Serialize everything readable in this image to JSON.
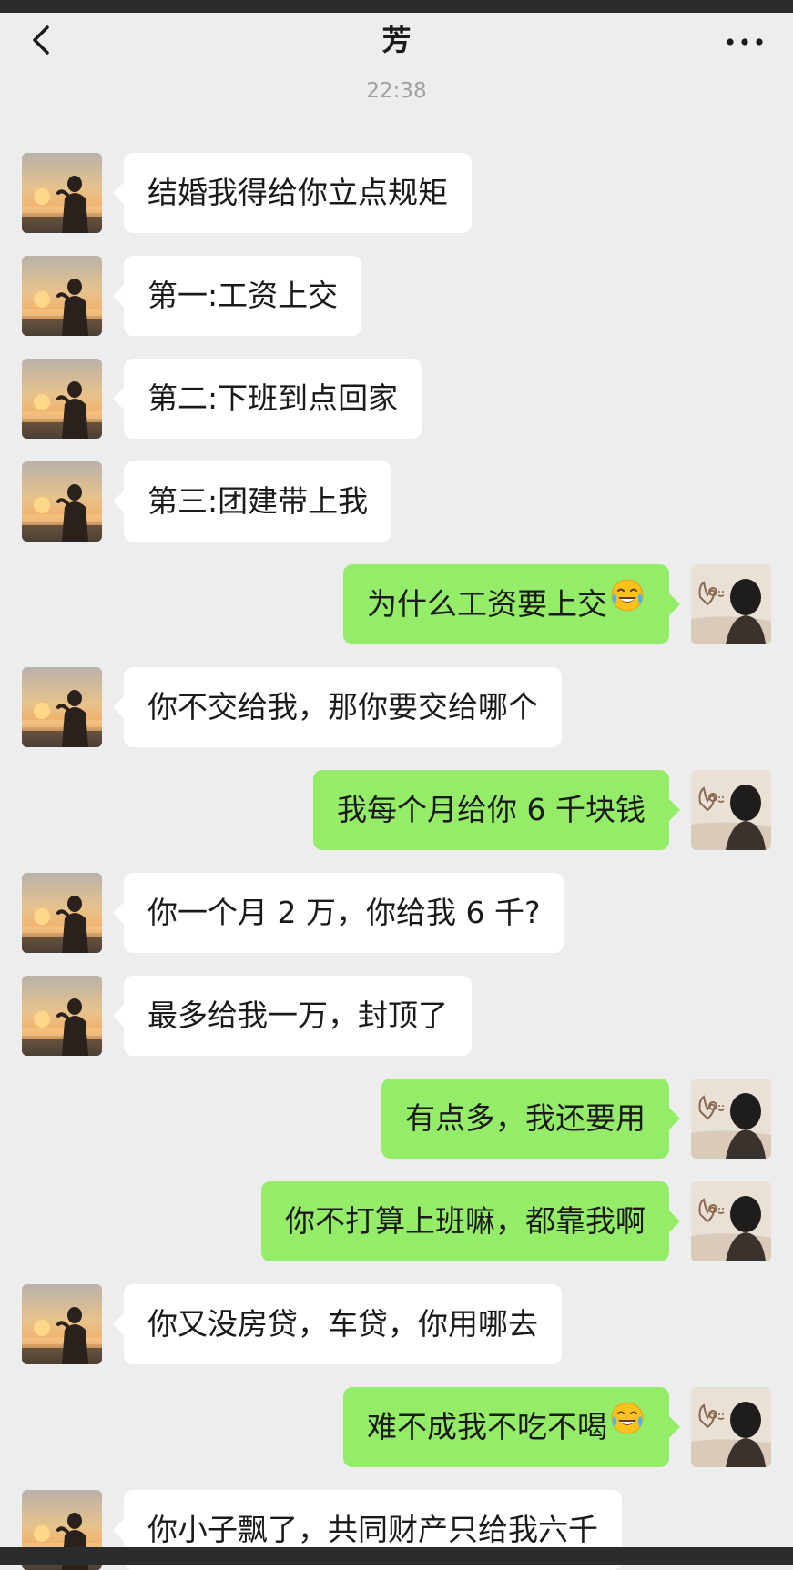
{
  "header": {
    "title": "芳",
    "back_icon": "chevron-left-icon",
    "more_icon": "more-dots-icon"
  },
  "chat": {
    "timestamp": "22:38",
    "messages": [
      {
        "side": "left",
        "text": "结婚我得给你立点规矩",
        "emoji": ""
      },
      {
        "side": "left",
        "text": "第一:工资上交",
        "emoji": ""
      },
      {
        "side": "left",
        "text": "第二:下班到点回家",
        "emoji": ""
      },
      {
        "side": "left",
        "text": "第三:团建带上我",
        "emoji": ""
      },
      {
        "side": "right",
        "text": "为什么工资要上交",
        "emoji": "laughing-crying-emoji"
      },
      {
        "side": "left",
        "text": "你不交给我，那你要交给哪个",
        "emoji": ""
      },
      {
        "side": "right",
        "text": "我每个月给你 6 千块钱",
        "emoji": ""
      },
      {
        "side": "left",
        "text": "你一个月 2 万，你给我 6 千?",
        "emoji": ""
      },
      {
        "side": "left",
        "text": "最多给我一万，封顶了",
        "emoji": ""
      },
      {
        "side": "right",
        "text": "有点多，我还要用",
        "emoji": ""
      },
      {
        "side": "right",
        "text": "你不打算上班嘛，都靠我啊",
        "emoji": ""
      },
      {
        "side": "left",
        "text": "你又没房贷，车贷，你用哪去",
        "emoji": ""
      },
      {
        "side": "right",
        "text": "难不成我不吃不喝",
        "emoji": "laughing-crying-emoji"
      },
      {
        "side": "left",
        "text": "你小子飘了，共同财产只给我六千",
        "emoji": ""
      }
    ]
  },
  "colors": {
    "background": "#ededed",
    "incoming_bubble": "#ffffff",
    "outgoing_bubble": "#95ec69",
    "timestamp": "#a0a0a0"
  }
}
